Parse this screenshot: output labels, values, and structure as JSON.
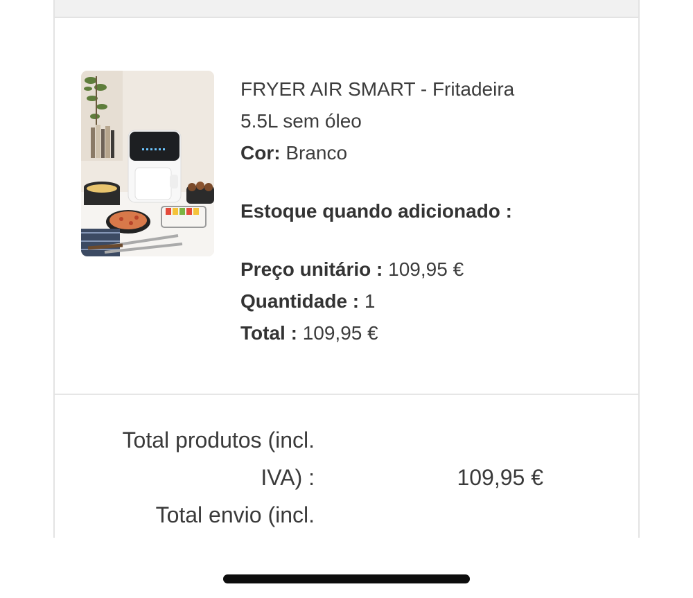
{
  "product": {
    "name_line1": "FRYER AIR SMART - Fritadeira",
    "name_line2": "5.5L sem óleo",
    "color_label": "Cor:",
    "color_value": "Branco",
    "stock_label": "Estoque quando adicionado :",
    "unit_price_label": "Preço unitário :",
    "unit_price_value": "109,95 €",
    "quantity_label": "Quantidade :",
    "quantity_value": "1",
    "total_label": "Total :",
    "total_value": "109,95 €"
  },
  "summary": {
    "products_total_label_line1": "Total produtos (incl.",
    "products_total_label_line2": "IVA) :",
    "products_total_value": "109,95 €",
    "shipping_total_label_line1": "Total envio (incl."
  }
}
